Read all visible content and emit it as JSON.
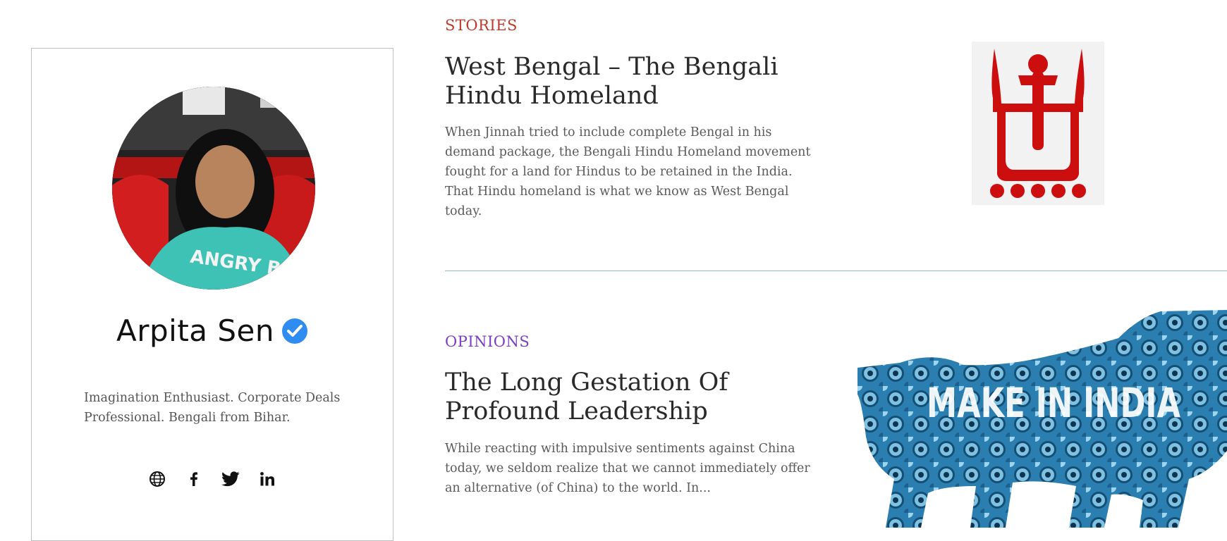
{
  "author": {
    "name": "Arpita Sen",
    "verified_icon": "verified-check-icon",
    "bio": "Imagination Enthusiast. Corporate Deals Professional. Bengali from Bihar.",
    "socials": [
      {
        "icon": "globe-icon",
        "glyph": "website"
      },
      {
        "icon": "facebook-icon",
        "glyph": "f"
      },
      {
        "icon": "twitter-icon",
        "glyph": "twitter"
      },
      {
        "icon": "linkedin-icon",
        "glyph": "in"
      }
    ]
  },
  "articles": [
    {
      "category": "STORIES",
      "category_color": "#c0392b",
      "title": "West Bengal – The Bengali Hindu Homeland",
      "excerpt": "When Jinnah tried to include complete Bengal in his demand package, the Bengali Hindu Homeland movement fought for a land for Hindus to be retained in the India. That Hindu homeland is what we know as West Bengal today."
    },
    {
      "category": "OPINIONS",
      "category_color": "#7b3fc4",
      "title": "The Long Gestation Of Profound Leadership",
      "excerpt": "While reacting with impulsive sentiments against China today, we seldom realize that we cannot immediately offer an alternative (of China) to the world. In...",
      "image_text": "MAKE IN INDIA"
    }
  ],
  "colors": {
    "divider": "#8fbfa8",
    "verified": "#2f8cf0",
    "symbol_red": "#cc0e0e",
    "lion_blue": "#2a7fb0"
  }
}
